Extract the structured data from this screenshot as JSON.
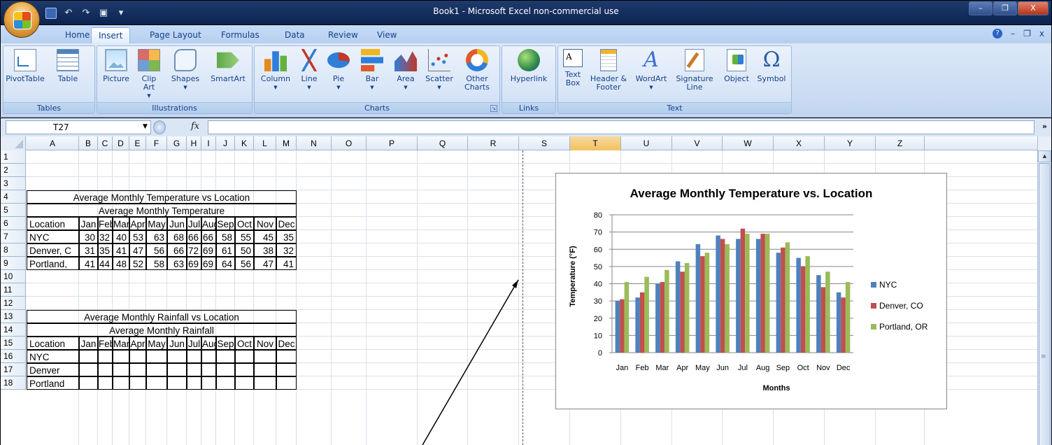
{
  "window": {
    "title": "Book1 - Microsoft Excel non-commercial use",
    "controls": [
      "–",
      "❐",
      "X"
    ]
  },
  "tabs": [
    "Home",
    "Insert",
    "Page Layout",
    "Formulas",
    "Data",
    "Review",
    "View"
  ],
  "active_tab": "Insert",
  "ribbon": {
    "groups": {
      "tables": "Tables",
      "illustrations": "Illustrations",
      "charts": "Charts",
      "links": "Links",
      "text": "Text"
    },
    "buttons": {
      "pivottable": "PivotTable",
      "table": "Table",
      "picture": "Picture",
      "clipart": "Clip Art",
      "shapes": "Shapes",
      "smartart": "SmartArt",
      "column": "Column",
      "line": "Line",
      "pie": "Pie",
      "bar": "Bar",
      "area": "Area",
      "scatter": "Scatter",
      "othercharts": "Other Charts",
      "hyperlink": "Hyperlink",
      "textbox": "Text Box",
      "headerfooter": "Header & Footer",
      "wordart": "WordArt",
      "signature": "Signature Line",
      "object": "Object",
      "symbol": "Symbol"
    }
  },
  "formula_bar": {
    "name_box": "T27",
    "fx": "fx",
    "value": ""
  },
  "columns": [
    "A",
    "B",
    "C",
    "D",
    "E",
    "F",
    "G",
    "H",
    "I",
    "J",
    "K",
    "L",
    "M",
    "N",
    "O",
    "P",
    "Q",
    "R",
    "S",
    "T",
    "U",
    "V",
    "W",
    "X",
    "Y",
    "Z"
  ],
  "selected_column": "T",
  "rows": [
    "1",
    "2",
    "3",
    "4",
    "5",
    "6",
    "7",
    "8",
    "9",
    "10",
    "11",
    "12",
    "13",
    "14",
    "15",
    "16",
    "17",
    "18"
  ],
  "sheet": {
    "temp_title": "Average Monthly Temperature vs Location",
    "temp_subtitle": "Average Monthly Temperature",
    "header": [
      "Location",
      "Jan",
      "Feb",
      "Mar",
      "Apr",
      "May",
      "Jun",
      "Jul",
      "Aug",
      "Sep",
      "Oct",
      "Nov",
      "Dec"
    ],
    "temp_rows": [
      [
        "NYC",
        "30",
        "32",
        "40",
        "53",
        "63",
        "68",
        "66",
        "66",
        "58",
        "55",
        "45",
        "35"
      ],
      [
        "Denver, C",
        "31",
        "35",
        "41",
        "47",
        "56",
        "66",
        "72",
        "69",
        "61",
        "50",
        "38",
        "32"
      ],
      [
        "Portland,",
        "41",
        "44",
        "48",
        "52",
        "58",
        "63",
        "69",
        "69",
        "64",
        "56",
        "47",
        "41"
      ]
    ],
    "rain_title": "Average Monthly Rainfall vs Location",
    "rain_subtitle": "Average Monthly Rainfall",
    "rain_locations": [
      "NYC",
      "Denver",
      "Portland"
    ]
  },
  "chart_data": {
    "type": "bar",
    "title": "Average Monthly Temperature vs. Location",
    "xlabel": "Months",
    "ylabel": "Temperature (°F)",
    "ylim": [
      0,
      80
    ],
    "yticks": [
      "0",
      "10",
      "20",
      "30",
      "40",
      "50",
      "60",
      "70",
      "80"
    ],
    "categories": [
      "Jan",
      "Feb",
      "Mar",
      "Apr",
      "May",
      "Jun",
      "Jul",
      "Aug",
      "Sep",
      "Oct",
      "Nov",
      "Dec"
    ],
    "series": [
      {
        "name": "NYC",
        "color": "#4f81bd",
        "values": [
          30,
          32,
          40,
          53,
          63,
          68,
          66,
          66,
          58,
          55,
          45,
          35
        ]
      },
      {
        "name": "Denver, CO",
        "color": "#c0504d",
        "values": [
          31,
          35,
          41,
          47,
          56,
          66,
          72,
          69,
          61,
          50,
          38,
          32
        ]
      },
      {
        "name": "Portland, OR",
        "color": "#9bbb59",
        "values": [
          41,
          44,
          48,
          52,
          58,
          63,
          69,
          69,
          64,
          56,
          47,
          41
        ]
      }
    ],
    "grid": true,
    "legend": "right"
  }
}
